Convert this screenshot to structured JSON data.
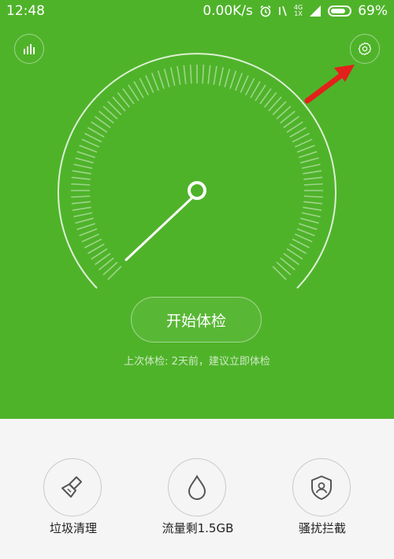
{
  "status_bar": {
    "time": "12:48",
    "net_speed": "0.00K/s",
    "network": "4G",
    "sim": "1X",
    "battery": "69%",
    "icons": [
      "alarm-icon",
      "mute-icon",
      "signal-icon",
      "battery-icon"
    ]
  },
  "header": {
    "stats_icon": "bar-chart-icon",
    "settings_icon": "gear-icon"
  },
  "gauge": {
    "level": 0.0
  },
  "main": {
    "start_button": "开始体检",
    "last_check": "上次体检: 2天前，建议立即体检"
  },
  "tools": [
    {
      "label": "垃圾清理",
      "icon": "broom-icon"
    },
    {
      "label": "流量剩1.5GB",
      "icon": "droplet-icon"
    },
    {
      "label": "骚扰拦截",
      "icon": "shield-user-icon"
    }
  ],
  "colors": {
    "primary": "#4fb32a",
    "bottom_bg": "#f5f5f5",
    "annotation": "#e3201b"
  }
}
